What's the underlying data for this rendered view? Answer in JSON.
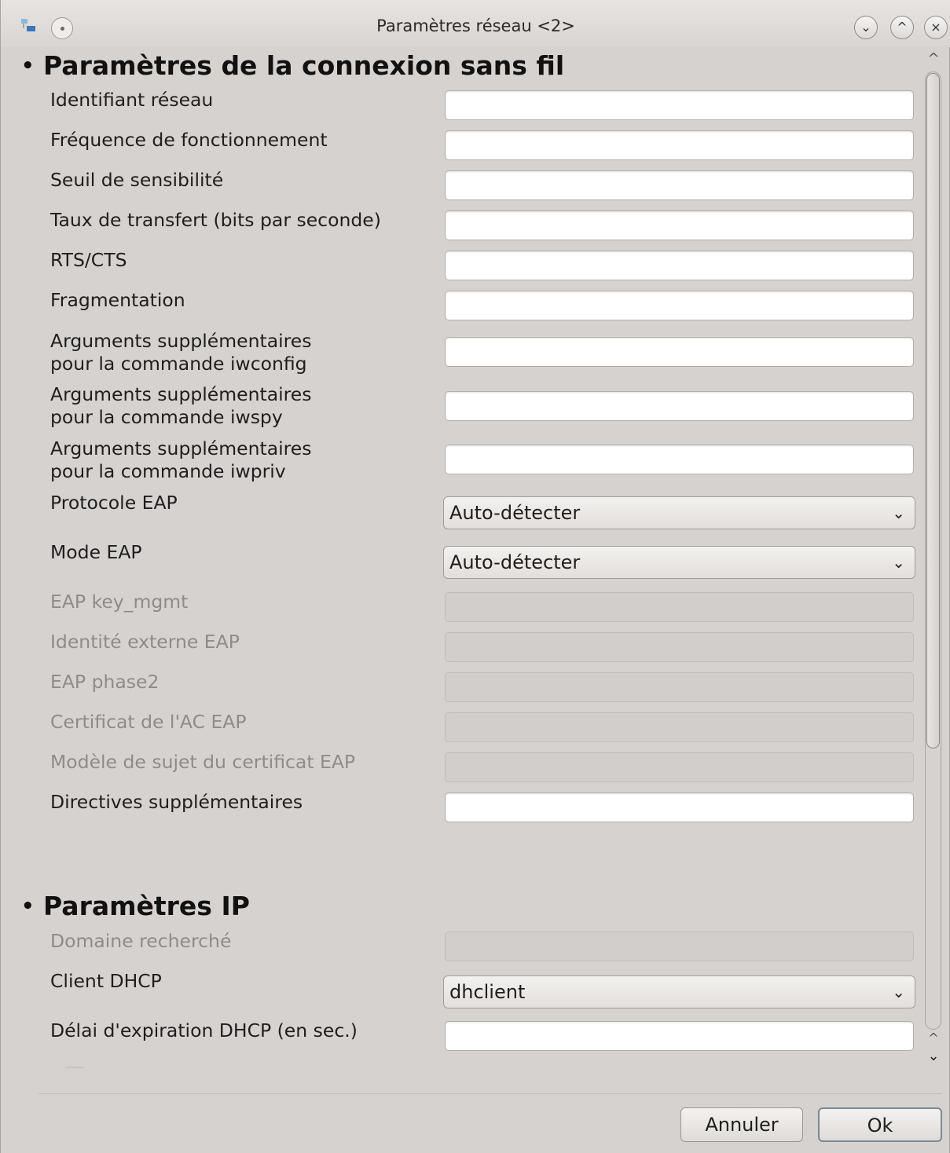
{
  "window": {
    "title": "Paramètres réseau <2>"
  },
  "sections": {
    "wireless": {
      "title": "Paramètres de la connexion sans fil",
      "fields": [
        {
          "label": "Identifiant réseau",
          "value": ""
        },
        {
          "label": "Fréquence de fonctionnement",
          "value": ""
        },
        {
          "label": "Seuil de sensibilité",
          "value": ""
        },
        {
          "label": "Taux de transfert (bits par seconde)",
          "value": ""
        },
        {
          "label": "RTS/CTS",
          "value": ""
        },
        {
          "label": "Fragmentation",
          "value": ""
        },
        {
          "label": "Arguments supplémentaires\npour la commande iwconfig",
          "value": ""
        },
        {
          "label": "Arguments supplémentaires\npour la commande iwspy",
          "value": ""
        },
        {
          "label": "Arguments supplémentaires\npour la commande iwpriv",
          "value": ""
        },
        {
          "label": "Protocole EAP",
          "value": "Auto-détecter"
        },
        {
          "label": "Mode EAP",
          "value": "Auto-détecter"
        },
        {
          "label": "EAP key_mgmt",
          "value": ""
        },
        {
          "label": "Identité externe EAP",
          "value": ""
        },
        {
          "label": "EAP phase2",
          "value": ""
        },
        {
          "label": "Certificat de l'AC EAP",
          "value": ""
        },
        {
          "label": "Modèle de sujet du certificat EAP",
          "value": ""
        },
        {
          "label": "Directives supplémentaires",
          "value": ""
        }
      ]
    },
    "ip": {
      "title": "Paramètres IP",
      "fields": [
        {
          "label": "Domaine recherché",
          "value": ""
        },
        {
          "label": "Client DHCP",
          "value": "dhclient"
        },
        {
          "label": "Délai d'expiration DHCP (en sec.)",
          "value": ""
        }
      ]
    }
  },
  "buttons": {
    "cancel": "Annuler",
    "ok": "Ok"
  },
  "icons": {
    "bullet": "•",
    "combo_arrow": "⌄",
    "scroll_up": "^",
    "scroll_down": "⌄",
    "minimize": "⌄",
    "maximize": "^",
    "close": "×"
  }
}
